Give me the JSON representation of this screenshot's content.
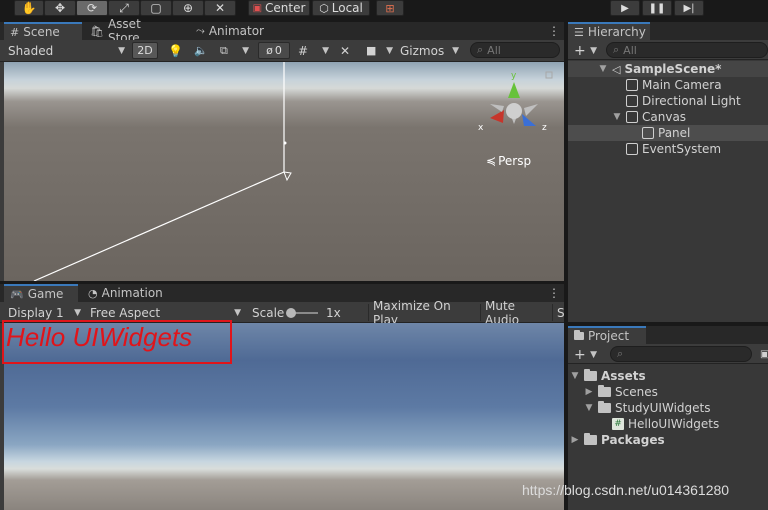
{
  "toolbar": {
    "center_label": "Center",
    "local_label": "Local"
  },
  "scene": {
    "tabs": [
      "Scene",
      "Asset Store",
      "Animator"
    ],
    "shading": "Shaded",
    "mode_2d": "2D",
    "hidden_count": "0",
    "gizmos": "Gizmos",
    "search_placeholder": "All",
    "persp_label": "Persp",
    "axes": {
      "x": "x",
      "y": "y",
      "z": "z"
    }
  },
  "game": {
    "tabs": [
      "Game",
      "Animation"
    ],
    "display": "Display 1",
    "aspect": "Free Aspect",
    "scale_label": "Scale",
    "scale_value": "1x",
    "maximize": "Maximize On Play",
    "mute": "Mute Audio",
    "stats_partial": "S",
    "hello_text": "Hello UIWidgets"
  },
  "hierarchy": {
    "tab": "Hierarchy",
    "search_placeholder": "All",
    "scene_name": "SampleScene*",
    "items": [
      "Main Camera",
      "Directional Light",
      "Canvas",
      "Panel",
      "EventSystem"
    ]
  },
  "project": {
    "tab": "Project",
    "assets": "Assets",
    "items": [
      "Scenes",
      "StudyUIWidgets",
      "HelloUIWidgets"
    ],
    "packages": "Packages"
  },
  "watermark": "https://blog.csdn.net/u014361280",
  "colors": {
    "accent": "#3a79bb",
    "hello_red": "#e0141a",
    "panel_bg": "#3c3c3c",
    "selected_row": "#4d4d4d"
  }
}
